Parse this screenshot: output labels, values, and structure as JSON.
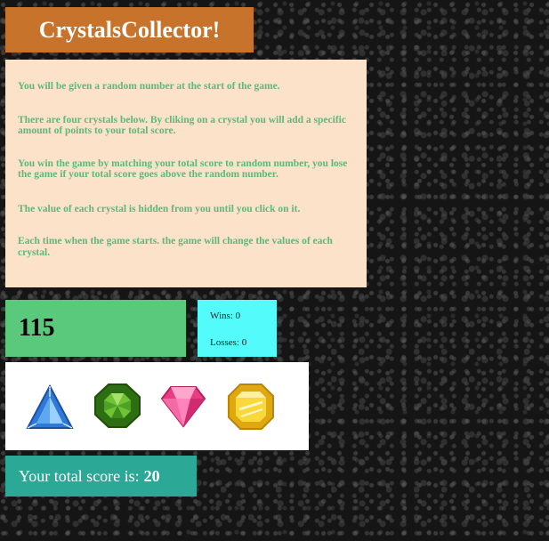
{
  "title": "CrystalsCollector!",
  "instructions": {
    "p1": "You will be given a random number at the start of the game.",
    "p2": "There are four crystals below. By cliking on a crystal you will add a specific amount of points to your total score.",
    "p3": "You win the game by matching your total score to random number, you lose the game if your total score goes above the random number.",
    "p4": "The value of each crystal is hidden from you until you click on it.",
    "p5": "Each time when the game starts. the game will change the values of each crystal."
  },
  "target_number": "115",
  "stats": {
    "wins": "Wins: 0",
    "losses": "Losses: 0"
  },
  "crystals": [
    {
      "name": "blue-triangle-crystal",
      "color": "#2f79d8"
    },
    {
      "name": "green-round-crystal",
      "color": "#3f9a1f"
    },
    {
      "name": "pink-diamond-crystal",
      "color": "#ea3c82"
    },
    {
      "name": "yellow-octagon-crystal",
      "color": "#f1c31c"
    }
  ],
  "score": {
    "label": "Your total score is:",
    "value": "20"
  }
}
